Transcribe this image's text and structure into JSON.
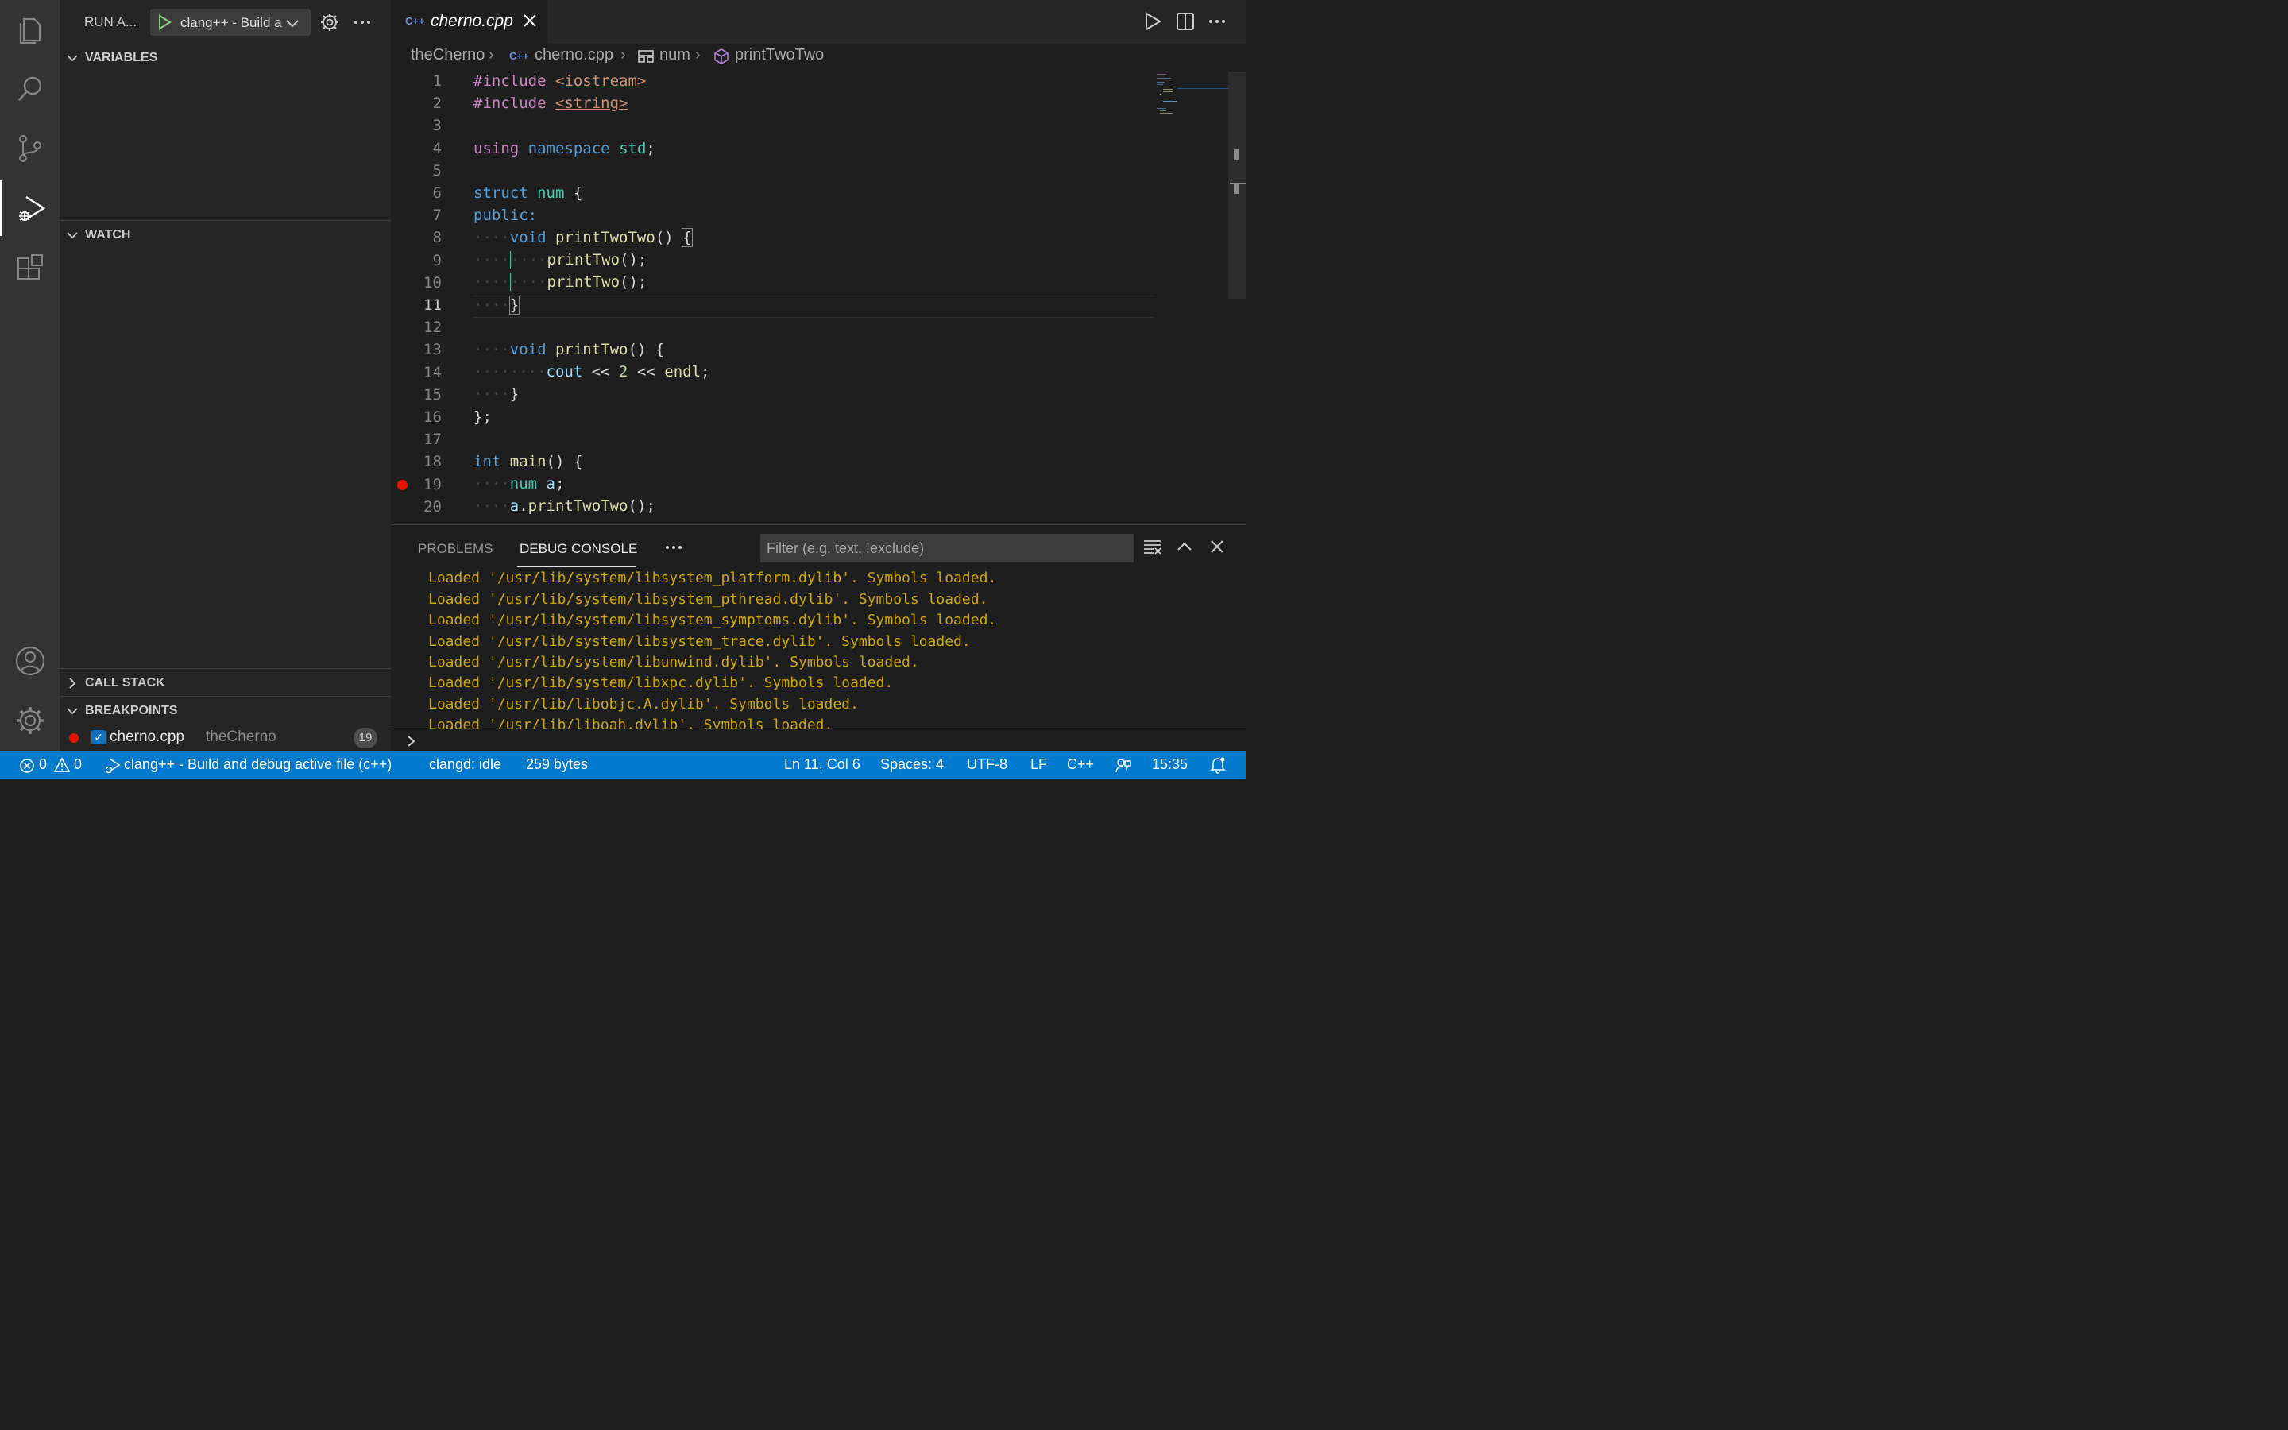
{
  "sidebar": {
    "run_title": "RUN A...",
    "config_label": "clang++ - Build and debug active file (c++)",
    "sections": {
      "variables": "VARIABLES",
      "watch": "WATCH",
      "call_stack": "CALL STACK",
      "breakpoints": "BREAKPOINTS"
    },
    "breakpoint": {
      "checked": true,
      "file": "cherno.cpp",
      "folder": "theCherno",
      "line": "19"
    }
  },
  "editor": {
    "tab": {
      "icon": "C++",
      "name": "cherno.cpp"
    },
    "breadcrumb": [
      "theCherno",
      "cherno.cpp",
      "num",
      "printTwoTwo"
    ],
    "line_numbers": [
      "1",
      "2",
      "3",
      "4",
      "5",
      "6",
      "7",
      "8",
      "9",
      "10",
      "11",
      "12",
      "13",
      "14",
      "15",
      "16",
      "17",
      "18",
      "19",
      "20"
    ],
    "current_line": "11",
    "breakpoint_line": "19"
  },
  "panel": {
    "tabs": [
      "PROBLEMS",
      "DEBUG CONSOLE"
    ],
    "active_tab": "DEBUG CONSOLE",
    "filter_placeholder": "Filter (e.g. text, !exclude)",
    "console_lines": [
      "Loaded '/usr/lib/system/libsystem_platform.dylib'. Symbols loaded.",
      "Loaded '/usr/lib/system/libsystem_pthread.dylib'. Symbols loaded.",
      "Loaded '/usr/lib/system/libsystem_symptoms.dylib'. Symbols loaded.",
      "Loaded '/usr/lib/system/libsystem_trace.dylib'. Symbols loaded.",
      "Loaded '/usr/lib/system/libunwind.dylib'. Symbols loaded.",
      "Loaded '/usr/lib/system/libxpc.dylib'. Symbols loaded.",
      "Loaded '/usr/lib/libobjc.A.dylib'. Symbols loaded.",
      "Loaded '/usr/lib/liboah.dylib'. Symbols loaded."
    ]
  },
  "status": {
    "errors": "0",
    "warnings": "0",
    "debug_config": "clang++ - Build and debug active file (c++)",
    "language_server": "clangd: idle",
    "file_size": "259 bytes",
    "cursor": "Ln 11, Col 6",
    "indent": "Spaces: 4",
    "encoding": "UTF-8",
    "eol": "LF",
    "language": "C++",
    "time": "15:35"
  },
  "colors": {
    "activity_bar": "#333333",
    "sidebar": "#252526",
    "editor": "#1e1e1e",
    "status_bar": "#007acc",
    "console_text": "#cca700",
    "breakpoint": "#e51400"
  }
}
